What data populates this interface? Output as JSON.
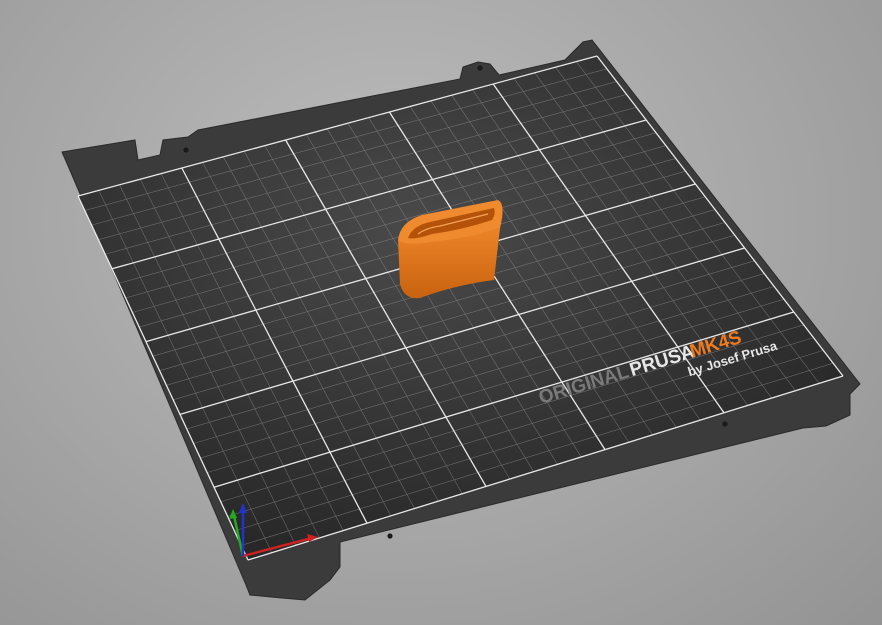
{
  "scene": {
    "app": "3D plater view",
    "bed_label": {
      "original": "ORIGINAL",
      "brand": "PRUSA",
      "model": "MK4S",
      "tagline": "by Josef Prusa"
    },
    "colors": {
      "background": "#a8a8a8",
      "bed_frame": "#3a3a3a",
      "bed_surface": "#2c2c2c",
      "grid_line": "#e6e6e6",
      "model": "#e77a1c",
      "brand_accent": "#f07a1e",
      "axis_x": "#cc2222",
      "axis_y": "#22aa22",
      "axis_z": "#2233cc"
    },
    "model_object": "orange curved band part",
    "axes_icon": "xyz-axes-icon"
  }
}
